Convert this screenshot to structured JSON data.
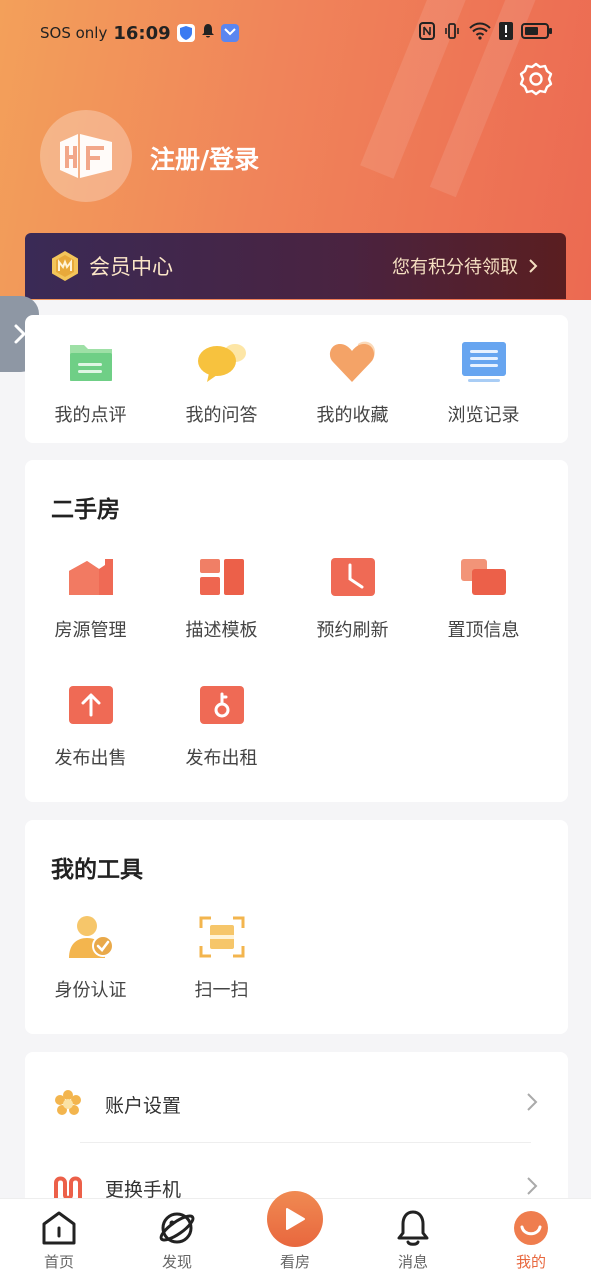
{
  "status_bar": {
    "carrier": "SOS only",
    "time": "16:09"
  },
  "header": {
    "login_label": "注册/登录",
    "avatar_text": "HF"
  },
  "member": {
    "title": "会员中心",
    "subtitle": "您有积分待领取"
  },
  "quick_actions": [
    {
      "label": "我的点评",
      "icon": "comment-doc-icon"
    },
    {
      "label": "我的问答",
      "icon": "qa-bubble-icon"
    },
    {
      "label": "我的收藏",
      "icon": "heart-icon"
    },
    {
      "label": "浏览记录",
      "icon": "history-doc-icon"
    }
  ],
  "second_hand": {
    "title": "二手房",
    "items": [
      {
        "label": "房源管理",
        "icon": "house-manage-icon"
      },
      {
        "label": "描述模板",
        "icon": "template-icon"
      },
      {
        "label": "预约刷新",
        "icon": "clock-icon"
      },
      {
        "label": "置顶信息",
        "icon": "pin-top-icon"
      },
      {
        "label": "发布出售",
        "icon": "upload-arrow-icon"
      },
      {
        "label": "发布出租",
        "icon": "key-icon"
      }
    ]
  },
  "tools": {
    "title": "我的工具",
    "items": [
      {
        "label": "身份认证",
        "icon": "identity-verify-icon"
      },
      {
        "label": "扫一扫",
        "icon": "scan-icon"
      }
    ]
  },
  "settings_list": [
    {
      "label": "账户设置",
      "icon": "gear-flower-icon"
    },
    {
      "label": "更换手机",
      "icon": "phone-change-icon"
    }
  ],
  "tabbar": [
    {
      "label": "首页",
      "icon": "home-icon"
    },
    {
      "label": "发现",
      "icon": "planet-icon"
    },
    {
      "label": "看房",
      "icon": "play-icon"
    },
    {
      "label": "消息",
      "icon": "bell-icon"
    },
    {
      "label": "我的",
      "icon": "smile-icon",
      "active": true
    }
  ],
  "colors": {
    "accent": "#e8683f",
    "header_start": "#f3a05a",
    "header_end": "#ec6a52",
    "member_bg": "#3a2a56"
  }
}
